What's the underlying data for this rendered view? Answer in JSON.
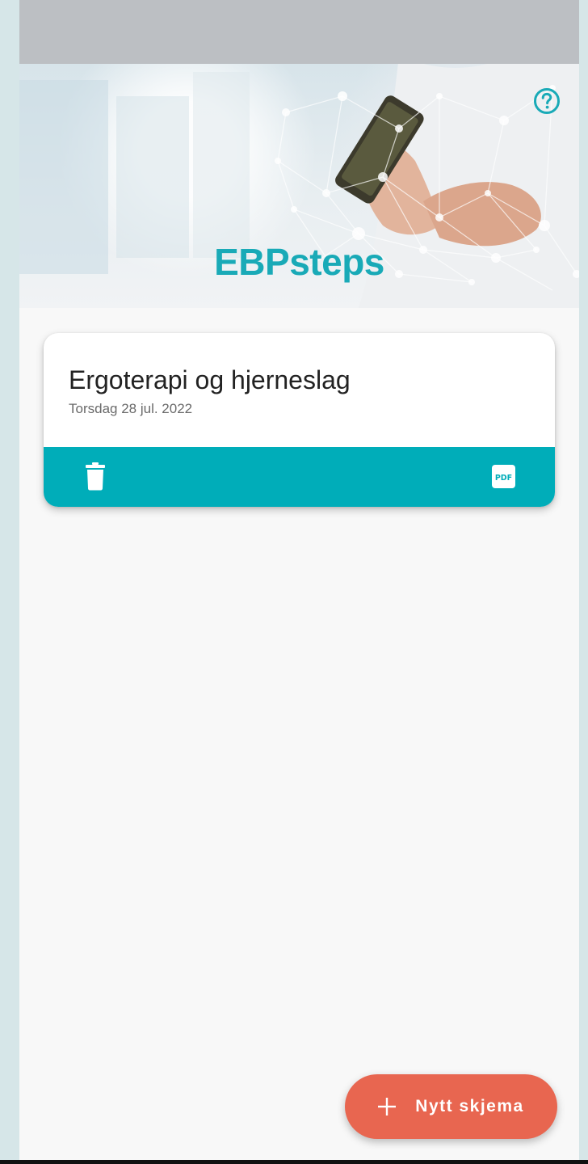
{
  "header": {
    "app_title": "EBPsteps",
    "help_icon": "question-circle-icon"
  },
  "forms": [
    {
      "title": "Ergoterapi og hjerneslag",
      "date": "Torsdag 28 jul. 2022",
      "actions": [
        "trash-icon",
        "pdf-icon"
      ]
    }
  ],
  "fab": {
    "label": "Nytt skjema",
    "icon": "plus-icon"
  },
  "colors": {
    "accent": "#00adb9",
    "title": "#19aab7",
    "fab": "#e86650",
    "background": "#f8f8f8"
  }
}
